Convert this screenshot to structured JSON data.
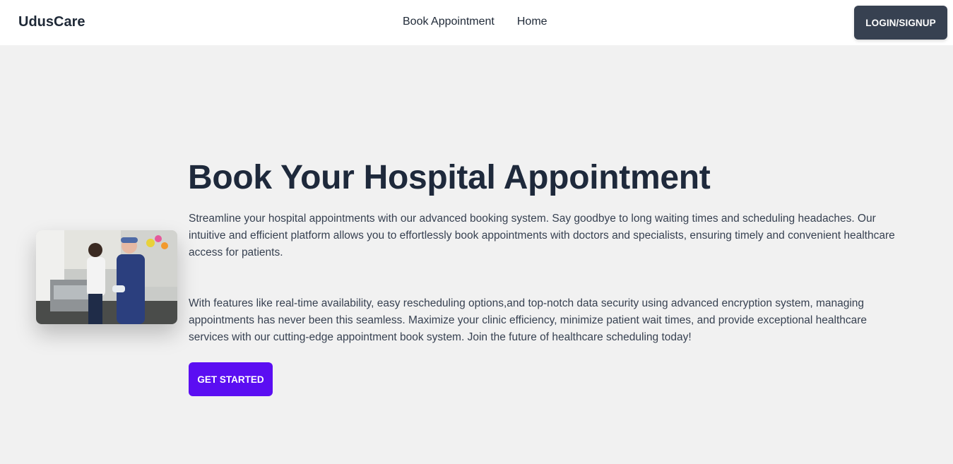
{
  "nav": {
    "brand": "UdusCare",
    "links": [
      "Book Appointment",
      "Home"
    ],
    "login_label": "LOGIN/SIGNUP"
  },
  "hero": {
    "title": "Book Your Hospital Appointment",
    "paragraph_1": "Streamline your hospital appointments with our advanced booking system. Say goodbye to long waiting times and scheduling headaches. Our intuitive and efficient platform allows you to effortlessly book appointments with doctors and specialists, ensuring timely and convenient healthcare access for patients.",
    "paragraph_2": "With features like real-time availability, easy rescheduling options,and top-notch data security using advanced encryption system, managing appointments has never been this seamless. Maximize your clinic efficiency, minimize patient wait times, and provide exceptional healthcare services with our cutting-edge appointment book system. Join the future of healthcare scheduling today!",
    "cta_label": "GET STARTED",
    "image": "hospital-staff-photo"
  },
  "colors": {
    "background": "#f1f1f1",
    "navbar": "#ffffff",
    "login_button": "#374151",
    "cta_button": "#5b0ef2",
    "title": "#1e293b"
  }
}
